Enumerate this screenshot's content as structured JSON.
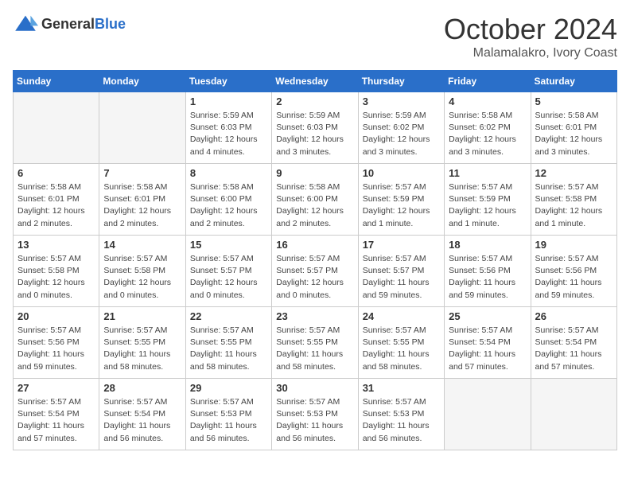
{
  "logo": {
    "general": "General",
    "blue": "Blue"
  },
  "title": "October 2024",
  "location": "Malamalakro, Ivory Coast",
  "days_header": [
    "Sunday",
    "Monday",
    "Tuesday",
    "Wednesday",
    "Thursday",
    "Friday",
    "Saturday"
  ],
  "weeks": [
    [
      {
        "day": "",
        "info": ""
      },
      {
        "day": "",
        "info": ""
      },
      {
        "day": "1",
        "info": "Sunrise: 5:59 AM\nSunset: 6:03 PM\nDaylight: 12 hours and 4 minutes."
      },
      {
        "day": "2",
        "info": "Sunrise: 5:59 AM\nSunset: 6:03 PM\nDaylight: 12 hours and 3 minutes."
      },
      {
        "day": "3",
        "info": "Sunrise: 5:59 AM\nSunset: 6:02 PM\nDaylight: 12 hours and 3 minutes."
      },
      {
        "day": "4",
        "info": "Sunrise: 5:58 AM\nSunset: 6:02 PM\nDaylight: 12 hours and 3 minutes."
      },
      {
        "day": "5",
        "info": "Sunrise: 5:58 AM\nSunset: 6:01 PM\nDaylight: 12 hours and 3 minutes."
      }
    ],
    [
      {
        "day": "6",
        "info": "Sunrise: 5:58 AM\nSunset: 6:01 PM\nDaylight: 12 hours and 2 minutes."
      },
      {
        "day": "7",
        "info": "Sunrise: 5:58 AM\nSunset: 6:01 PM\nDaylight: 12 hours and 2 minutes."
      },
      {
        "day": "8",
        "info": "Sunrise: 5:58 AM\nSunset: 6:00 PM\nDaylight: 12 hours and 2 minutes."
      },
      {
        "day": "9",
        "info": "Sunrise: 5:58 AM\nSunset: 6:00 PM\nDaylight: 12 hours and 2 minutes."
      },
      {
        "day": "10",
        "info": "Sunrise: 5:57 AM\nSunset: 5:59 PM\nDaylight: 12 hours and 1 minute."
      },
      {
        "day": "11",
        "info": "Sunrise: 5:57 AM\nSunset: 5:59 PM\nDaylight: 12 hours and 1 minute."
      },
      {
        "day": "12",
        "info": "Sunrise: 5:57 AM\nSunset: 5:58 PM\nDaylight: 12 hours and 1 minute."
      }
    ],
    [
      {
        "day": "13",
        "info": "Sunrise: 5:57 AM\nSunset: 5:58 PM\nDaylight: 12 hours and 0 minutes."
      },
      {
        "day": "14",
        "info": "Sunrise: 5:57 AM\nSunset: 5:58 PM\nDaylight: 12 hours and 0 minutes."
      },
      {
        "day": "15",
        "info": "Sunrise: 5:57 AM\nSunset: 5:57 PM\nDaylight: 12 hours and 0 minutes."
      },
      {
        "day": "16",
        "info": "Sunrise: 5:57 AM\nSunset: 5:57 PM\nDaylight: 12 hours and 0 minutes."
      },
      {
        "day": "17",
        "info": "Sunrise: 5:57 AM\nSunset: 5:57 PM\nDaylight: 11 hours and 59 minutes."
      },
      {
        "day": "18",
        "info": "Sunrise: 5:57 AM\nSunset: 5:56 PM\nDaylight: 11 hours and 59 minutes."
      },
      {
        "day": "19",
        "info": "Sunrise: 5:57 AM\nSunset: 5:56 PM\nDaylight: 11 hours and 59 minutes."
      }
    ],
    [
      {
        "day": "20",
        "info": "Sunrise: 5:57 AM\nSunset: 5:56 PM\nDaylight: 11 hours and 59 minutes."
      },
      {
        "day": "21",
        "info": "Sunrise: 5:57 AM\nSunset: 5:55 PM\nDaylight: 11 hours and 58 minutes."
      },
      {
        "day": "22",
        "info": "Sunrise: 5:57 AM\nSunset: 5:55 PM\nDaylight: 11 hours and 58 minutes."
      },
      {
        "day": "23",
        "info": "Sunrise: 5:57 AM\nSunset: 5:55 PM\nDaylight: 11 hours and 58 minutes."
      },
      {
        "day": "24",
        "info": "Sunrise: 5:57 AM\nSunset: 5:55 PM\nDaylight: 11 hours and 58 minutes."
      },
      {
        "day": "25",
        "info": "Sunrise: 5:57 AM\nSunset: 5:54 PM\nDaylight: 11 hours and 57 minutes."
      },
      {
        "day": "26",
        "info": "Sunrise: 5:57 AM\nSunset: 5:54 PM\nDaylight: 11 hours and 57 minutes."
      }
    ],
    [
      {
        "day": "27",
        "info": "Sunrise: 5:57 AM\nSunset: 5:54 PM\nDaylight: 11 hours and 57 minutes."
      },
      {
        "day": "28",
        "info": "Sunrise: 5:57 AM\nSunset: 5:54 PM\nDaylight: 11 hours and 56 minutes."
      },
      {
        "day": "29",
        "info": "Sunrise: 5:57 AM\nSunset: 5:53 PM\nDaylight: 11 hours and 56 minutes."
      },
      {
        "day": "30",
        "info": "Sunrise: 5:57 AM\nSunset: 5:53 PM\nDaylight: 11 hours and 56 minutes."
      },
      {
        "day": "31",
        "info": "Sunrise: 5:57 AM\nSunset: 5:53 PM\nDaylight: 11 hours and 56 minutes."
      },
      {
        "day": "",
        "info": ""
      },
      {
        "day": "",
        "info": ""
      }
    ]
  ]
}
